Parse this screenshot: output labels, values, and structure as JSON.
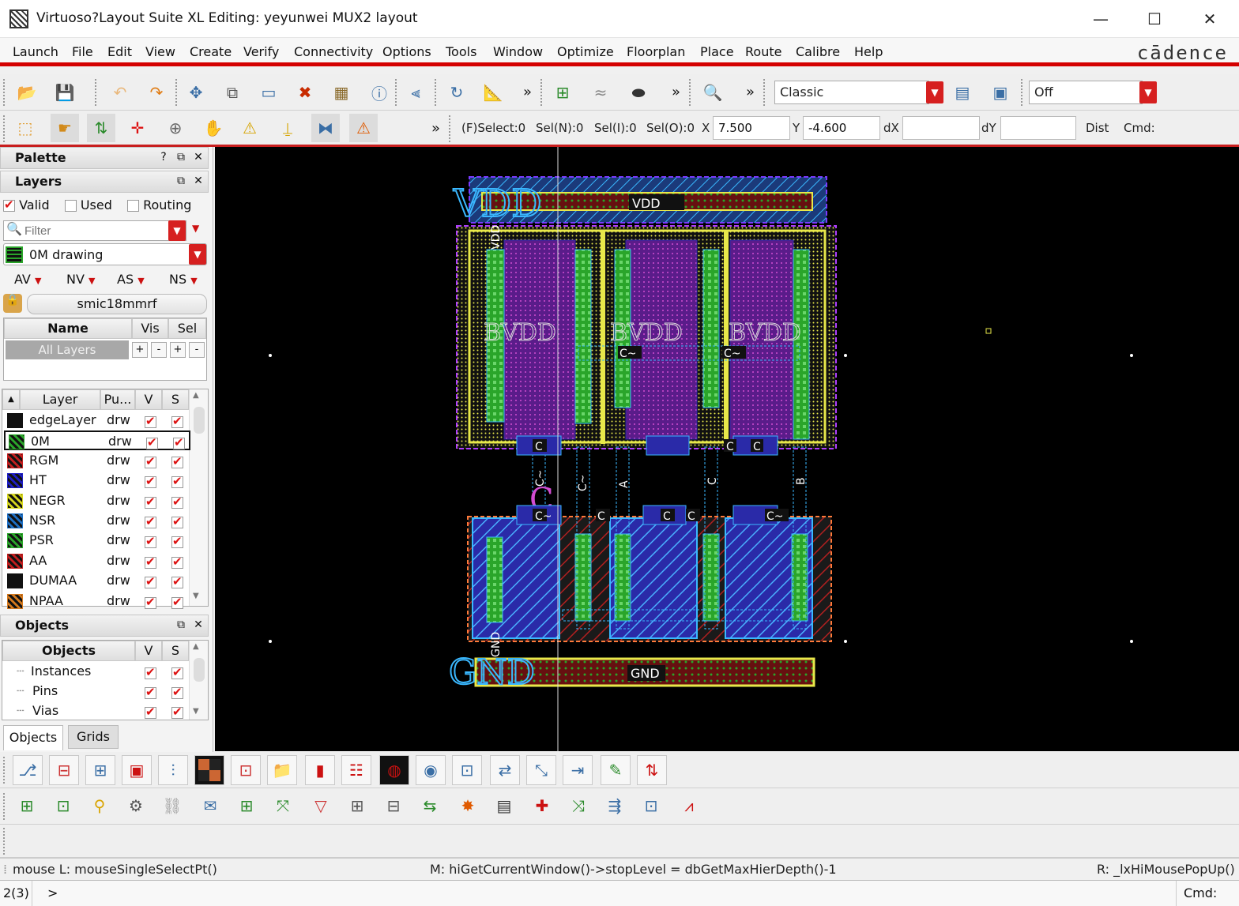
{
  "window": {
    "title": "Virtuoso?Layout Suite XL Editing: yeyunwei MUX2 layout",
    "minimize": "—",
    "maximize": "☐",
    "close": "✕"
  },
  "menu": {
    "items": [
      "Launch",
      "File",
      "Edit",
      "View",
      "Create",
      "Verify",
      "Connectivity",
      "Options",
      "Tools",
      "Window",
      "Optimize",
      "Floorplan",
      "Place",
      "Route",
      "Calibre",
      "Help"
    ],
    "brand": "cādence"
  },
  "toolbar1": {
    "more1": "»",
    "more2": "»",
    "more3": "»",
    "workspace": "Classic",
    "mode": "Off"
  },
  "toolbar2": {
    "more": "»",
    "fselect": "(F)Select:0",
    "seln": "Sel(N):0",
    "seli": "Sel(I):0",
    "selo": "Sel(O):0",
    "x_label": "X",
    "x_value": "7.500",
    "y_label": "Y",
    "y_value": "-4.600",
    "dx_label": "dX",
    "dx_value": "",
    "dy_label": "dY",
    "dy_value": "",
    "dist_label": "Dist",
    "cmd_label": "Cmd:"
  },
  "palette": {
    "title": "Palette",
    "help": "?"
  },
  "layers": {
    "title": "Layers",
    "valid": "Valid",
    "used": "Used",
    "routing": "Routing",
    "filter_placeholder": "Filter",
    "current_layer": "0M drawing",
    "filters": [
      "AV",
      "NV",
      "AS",
      "NS"
    ],
    "library": "smic18mmrf",
    "set_cols": {
      "name": "Name",
      "vis": "Vis",
      "sel": "Sel"
    },
    "all_layers": "All Layers",
    "pm": [
      "+",
      "-",
      "+",
      "-"
    ],
    "cols": {
      "layer": "Layer",
      "purpose": "Pu...",
      "v": "V",
      "s": "S"
    },
    "rows": [
      {
        "name": "edgeLayer",
        "purpose": "drw",
        "color": "#111111"
      },
      {
        "name": "0M",
        "purpose": "drw",
        "color": "#2aa52a"
      },
      {
        "name": "RGM",
        "purpose": "drw",
        "color": "#c41e1e"
      },
      {
        "name": "HT",
        "purpose": "drw",
        "color": "#1e1ec4"
      },
      {
        "name": "NEGR",
        "purpose": "drw",
        "color": "#d6d61e"
      },
      {
        "name": "NSR",
        "purpose": "drw",
        "color": "#1e6fc4"
      },
      {
        "name": "PSR",
        "purpose": "drw",
        "color": "#2aa52a"
      },
      {
        "name": "AA",
        "purpose": "drw",
        "color": "#c41e1e"
      },
      {
        "name": "DUMAA",
        "purpose": "drw",
        "color": "#111111"
      },
      {
        "name": "NPAA",
        "purpose": "drw",
        "color": "#d4791e"
      }
    ]
  },
  "objects": {
    "title": "Objects",
    "cols": {
      "name": "Objects",
      "v": "V",
      "s": "S"
    },
    "rows": [
      "Instances",
      "Pins",
      "Vias"
    ],
    "tabs": [
      "Objects",
      "Grids"
    ]
  },
  "layout": {
    "vdd_label": "VDD",
    "gnd_label": "GND",
    "vdd_big": "VDD",
    "gnd_big": "GND",
    "vdd_vertical": "VDD",
    "gnd_vertical": "GND",
    "inst_labels": [
      "C",
      "C",
      "C",
      "C~",
      "C",
      "C",
      "C~",
      "C"
    ],
    "gate_labels": [
      "C~",
      "A",
      "C",
      "B",
      "C~"
    ],
    "top_nets": [
      "C~",
      "C~"
    ]
  },
  "status": {
    "left": "mouse L: mouseSingleSelectPt()",
    "middle": "M: hiGetCurrentWindow()->stopLevel = dbGetMaxHierDepth()-1",
    "right": "R: _lxHiMousePopUp()"
  },
  "cmdline": {
    "count": "2(3)",
    "prompt": ">",
    "cmd": "Cmd:"
  }
}
